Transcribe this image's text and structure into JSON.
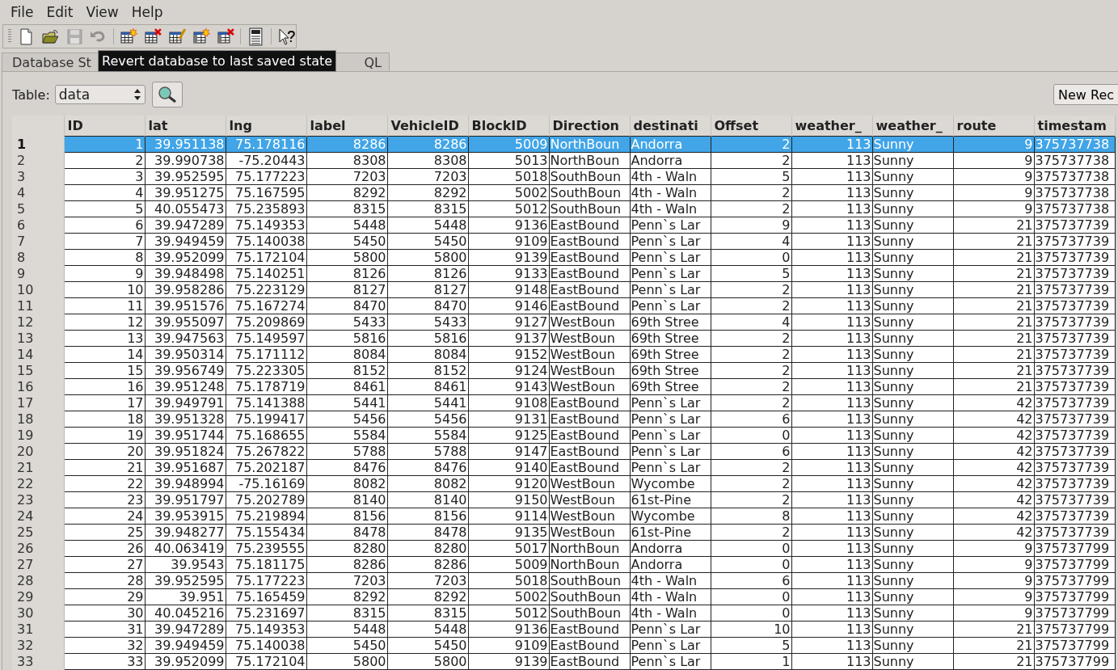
{
  "menu": [
    "File",
    "Edit",
    "View",
    "Help"
  ],
  "toolbar": [
    {
      "kind": "new",
      "disabled": false
    },
    {
      "kind": "open",
      "disabled": false
    },
    {
      "kind": "save",
      "disabled": true
    },
    {
      "kind": "undo",
      "disabled": true
    },
    {
      "kind": "sep"
    },
    {
      "kind": "table-new",
      "disabled": false
    },
    {
      "kind": "table-delete",
      "disabled": false
    },
    {
      "kind": "table-edit",
      "disabled": false
    },
    {
      "kind": "index-new",
      "disabled": false
    },
    {
      "kind": "index-delete",
      "disabled": false
    },
    {
      "kind": "sep"
    },
    {
      "kind": "log",
      "disabled": false
    },
    {
      "kind": "sep"
    },
    {
      "kind": "help",
      "disabled": false
    }
  ],
  "tooltip": "Revert database to last saved state",
  "tabs": [
    {
      "label": "Database St",
      "selected": false
    },
    {
      "label": "QL",
      "selected": false
    }
  ],
  "table_label": "Table:",
  "table_select": "data",
  "new_record_button": "New Rec",
  "columns": [
    {
      "label": "ID",
      "kind": "number"
    },
    {
      "label": "lat",
      "kind": "number"
    },
    {
      "label": "lng",
      "kind": "number"
    },
    {
      "label": "label",
      "kind": "number"
    },
    {
      "label": "VehicleID",
      "kind": "number"
    },
    {
      "label": "BlockID",
      "kind": "number"
    },
    {
      "label": "Direction",
      "kind": "text"
    },
    {
      "label": "destinati",
      "kind": "text"
    },
    {
      "label": "Offset",
      "kind": "number"
    },
    {
      "label": "weather_",
      "kind": "number"
    },
    {
      "label": "weather_",
      "kind": "text"
    },
    {
      "label": "route",
      "kind": "number"
    },
    {
      "label": "timestam",
      "kind": "text"
    }
  ],
  "rows": [
    {
      "number": "1",
      "selected": true,
      "cells": [
        "1",
        "39.951138",
        "75.178116",
        "8286",
        "8286",
        "5009",
        "NorthBoun",
        "Andorra",
        "2",
        "113",
        "Sunny",
        "9",
        "375737738"
      ]
    },
    {
      "number": "2",
      "selected": false,
      "cells": [
        "2",
        "39.990738",
        "-75.20443",
        "8308",
        "8308",
        "5013",
        "NorthBoun",
        "Andorra",
        "2",
        "113",
        "Sunny",
        "9",
        "375737738"
      ]
    },
    {
      "number": "3",
      "selected": false,
      "cells": [
        "3",
        "39.952595",
        "75.177223",
        "7203",
        "7203",
        "5018",
        "SouthBoun",
        "4th - Waln",
        "5",
        "113",
        "Sunny",
        "9",
        "375737738"
      ]
    },
    {
      "number": "4",
      "selected": false,
      "cells": [
        "4",
        "39.951275",
        "75.167595",
        "8292",
        "8292",
        "5002",
        "SouthBoun",
        "4th - Waln",
        "2",
        "113",
        "Sunny",
        "9",
        "375737738"
      ]
    },
    {
      "number": "5",
      "selected": false,
      "cells": [
        "5",
        "40.055473",
        "75.235893",
        "8315",
        "8315",
        "5012",
        "SouthBoun",
        "4th - Waln",
        "2",
        "113",
        "Sunny",
        "9",
        "375737738"
      ]
    },
    {
      "number": "6",
      "selected": false,
      "cells": [
        "6",
        "39.947289",
        "75.149353",
        "5448",
        "5448",
        "9136",
        "EastBound",
        "Penn`s Lar",
        "9",
        "113",
        "Sunny",
        "21",
        "375737739"
      ]
    },
    {
      "number": "7",
      "selected": false,
      "cells": [
        "7",
        "39.949459",
        "75.140038",
        "5450",
        "5450",
        "9109",
        "EastBound",
        "Penn`s Lar",
        "4",
        "113",
        "Sunny",
        "21",
        "375737739"
      ]
    },
    {
      "number": "8",
      "selected": false,
      "cells": [
        "8",
        "39.952099",
        "75.172104",
        "5800",
        "5800",
        "9139",
        "EastBound",
        "Penn`s Lar",
        "0",
        "113",
        "Sunny",
        "21",
        "375737739"
      ]
    },
    {
      "number": "9",
      "selected": false,
      "cells": [
        "9",
        "39.948498",
        "75.140251",
        "8126",
        "8126",
        "9133",
        "EastBound",
        "Penn`s Lar",
        "5",
        "113",
        "Sunny",
        "21",
        "375737739"
      ]
    },
    {
      "number": "10",
      "selected": false,
      "cells": [
        "10",
        "39.958286",
        "75.223129",
        "8127",
        "8127",
        "9148",
        "EastBound",
        "Penn`s Lar",
        "2",
        "113",
        "Sunny",
        "21",
        "375737739"
      ]
    },
    {
      "number": "11",
      "selected": false,
      "cells": [
        "11",
        "39.951576",
        "75.167274",
        "8470",
        "8470",
        "9146",
        "EastBound",
        "Penn`s Lar",
        "2",
        "113",
        "Sunny",
        "21",
        "375737739"
      ]
    },
    {
      "number": "12",
      "selected": false,
      "cells": [
        "12",
        "39.955097",
        "75.209869",
        "5433",
        "5433",
        "9127",
        "WestBoun",
        "69th Stree",
        "4",
        "113",
        "Sunny",
        "21",
        "375737739"
      ]
    },
    {
      "number": "13",
      "selected": false,
      "cells": [
        "13",
        "39.947563",
        "75.149597",
        "5816",
        "5816",
        "9137",
        "WestBoun",
        "69th Stree",
        "2",
        "113",
        "Sunny",
        "21",
        "375737739"
      ]
    },
    {
      "number": "14",
      "selected": false,
      "cells": [
        "14",
        "39.950314",
        "75.171112",
        "8084",
        "8084",
        "9152",
        "WestBoun",
        "69th Stree",
        "2",
        "113",
        "Sunny",
        "21",
        "375737739"
      ]
    },
    {
      "number": "15",
      "selected": false,
      "cells": [
        "15",
        "39.956749",
        "75.223305",
        "8152",
        "8152",
        "9124",
        "WestBoun",
        "69th Stree",
        "2",
        "113",
        "Sunny",
        "21",
        "375737739"
      ]
    },
    {
      "number": "16",
      "selected": false,
      "cells": [
        "16",
        "39.951248",
        "75.178719",
        "8461",
        "8461",
        "9143",
        "WestBoun",
        "69th Stree",
        "2",
        "113",
        "Sunny",
        "21",
        "375737739"
      ]
    },
    {
      "number": "17",
      "selected": false,
      "cells": [
        "17",
        "39.949791",
        "75.141388",
        "5441",
        "5441",
        "9108",
        "EastBound",
        "Penn`s Lar",
        "2",
        "113",
        "Sunny",
        "42",
        "375737739"
      ]
    },
    {
      "number": "18",
      "selected": false,
      "cells": [
        "18",
        "39.951328",
        "75.199417",
        "5456",
        "5456",
        "9131",
        "EastBound",
        "Penn`s Lar",
        "6",
        "113",
        "Sunny",
        "42",
        "375737739"
      ]
    },
    {
      "number": "19",
      "selected": false,
      "cells": [
        "19",
        "39.951744",
        "75.168655",
        "5584",
        "5584",
        "9125",
        "EastBound",
        "Penn`s Lar",
        "0",
        "113",
        "Sunny",
        "42",
        "375737739"
      ]
    },
    {
      "number": "20",
      "selected": false,
      "cells": [
        "20",
        "39.951824",
        "75.267822",
        "5788",
        "5788",
        "9147",
        "EastBound",
        "Penn`s Lar",
        "6",
        "113",
        "Sunny",
        "42",
        "375737739"
      ]
    },
    {
      "number": "21",
      "selected": false,
      "cells": [
        "21",
        "39.951687",
        "75.202187",
        "8476",
        "8476",
        "9140",
        "EastBound",
        "Penn`s Lar",
        "2",
        "113",
        "Sunny",
        "42",
        "375737739"
      ]
    },
    {
      "number": "22",
      "selected": false,
      "cells": [
        "22",
        "39.948994",
        "-75.16169",
        "8082",
        "8082",
        "9120",
        "WestBoun",
        "Wycombe",
        "2",
        "113",
        "Sunny",
        "42",
        "375737739"
      ]
    },
    {
      "number": "23",
      "selected": false,
      "cells": [
        "23",
        "39.951797",
        "75.202789",
        "8140",
        "8140",
        "9150",
        "WestBoun",
        "61st-Pine",
        "2",
        "113",
        "Sunny",
        "42",
        "375737739"
      ]
    },
    {
      "number": "24",
      "selected": false,
      "cells": [
        "24",
        "39.953915",
        "75.219894",
        "8156",
        "8156",
        "9114",
        "WestBoun",
        "Wycombe",
        "8",
        "113",
        "Sunny",
        "42",
        "375737739"
      ]
    },
    {
      "number": "25",
      "selected": false,
      "cells": [
        "25",
        "39.948277",
        "75.155434",
        "8478",
        "8478",
        "9135",
        "WestBoun",
        "61st-Pine",
        "2",
        "113",
        "Sunny",
        "42",
        "375737739"
      ]
    },
    {
      "number": "26",
      "selected": false,
      "cells": [
        "26",
        "40.063419",
        "75.239555",
        "8280",
        "8280",
        "5017",
        "NorthBoun",
        "Andorra",
        "0",
        "113",
        "Sunny",
        "9",
        "375737799"
      ]
    },
    {
      "number": "27",
      "selected": false,
      "cells": [
        "27",
        "39.9543",
        "75.181175",
        "8286",
        "8286",
        "5009",
        "NorthBoun",
        "Andorra",
        "0",
        "113",
        "Sunny",
        "9",
        "375737799"
      ]
    },
    {
      "number": "28",
      "selected": false,
      "cells": [
        "28",
        "39.952595",
        "75.177223",
        "7203",
        "7203",
        "5018",
        "SouthBoun",
        "4th - Waln",
        "6",
        "113",
        "Sunny",
        "9",
        "375737799"
      ]
    },
    {
      "number": "29",
      "selected": false,
      "cells": [
        "29",
        "39.951",
        "75.165459",
        "8292",
        "8292",
        "5002",
        "SouthBoun",
        "4th - Waln",
        "0",
        "113",
        "Sunny",
        "9",
        "375737799"
      ]
    },
    {
      "number": "30",
      "selected": false,
      "cells": [
        "30",
        "40.045216",
        "75.231697",
        "8315",
        "8315",
        "5012",
        "SouthBoun",
        "4th - Waln",
        "0",
        "113",
        "Sunny",
        "9",
        "375737799"
      ]
    },
    {
      "number": "31",
      "selected": false,
      "cells": [
        "31",
        "39.947289",
        "75.149353",
        "5448",
        "5448",
        "9136",
        "EastBound",
        "Penn`s Lar",
        "10",
        "113",
        "Sunny",
        "21",
        "375737799"
      ]
    },
    {
      "number": "32",
      "selected": false,
      "cells": [
        "32",
        "39.949459",
        "75.140038",
        "5450",
        "5450",
        "9109",
        "EastBound",
        "Penn`s Lar",
        "5",
        "113",
        "Sunny",
        "21",
        "375737799"
      ]
    },
    {
      "number": "33",
      "selected": false,
      "cells": [
        "33",
        "39.952099",
        "75.172104",
        "5800",
        "5800",
        "9139",
        "EastBound",
        "Penn`s Lar",
        "1",
        "113",
        "Sunny",
        "21",
        "375737799"
      ]
    }
  ]
}
